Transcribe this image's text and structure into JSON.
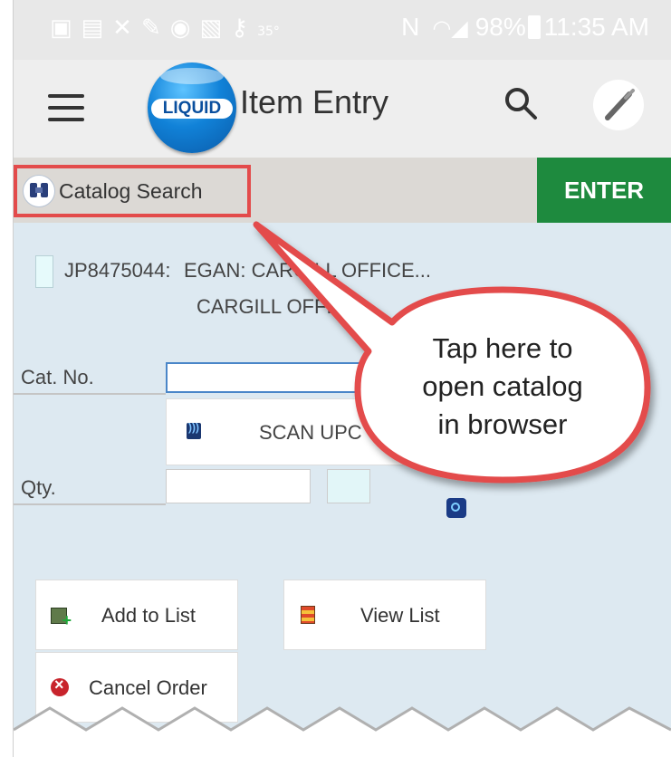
{
  "status_bar": {
    "icons": [
      "message-icon",
      "image-icon",
      "cross-icon",
      "wrench-icon",
      "location-icon",
      "gallery-icon",
      "key-icon"
    ],
    "temp": "35°",
    "nfc": "N",
    "battery": "98%",
    "time": "11:35 AM"
  },
  "app_bar": {
    "logo_text": "LIQUID",
    "title": "Item Entry"
  },
  "toolbar": {
    "catalog_search": "Catalog Search",
    "enter": "ENTER"
  },
  "order": {
    "id": "JP8475044:",
    "line1": "EGAN: CARGILL OFFICE...",
    "line2": "CARGILL OFFICE"
  },
  "form": {
    "cat_no_label": "Cat. No.",
    "cat_no_value": "",
    "scan_label": "SCAN UPC",
    "qty_label": "Qty.",
    "qty_value": ""
  },
  "buttons": {
    "add_to_list": "Add to List",
    "view_list": "View List",
    "cancel_order": "Cancel Order"
  },
  "callout": {
    "line1": "Tap here to",
    "line2": "open catalog",
    "line3": "in browser"
  },
  "colors": {
    "accent_green": "#1e8a3e",
    "highlight_red": "#e34b4b",
    "background": "#dde9f1"
  }
}
